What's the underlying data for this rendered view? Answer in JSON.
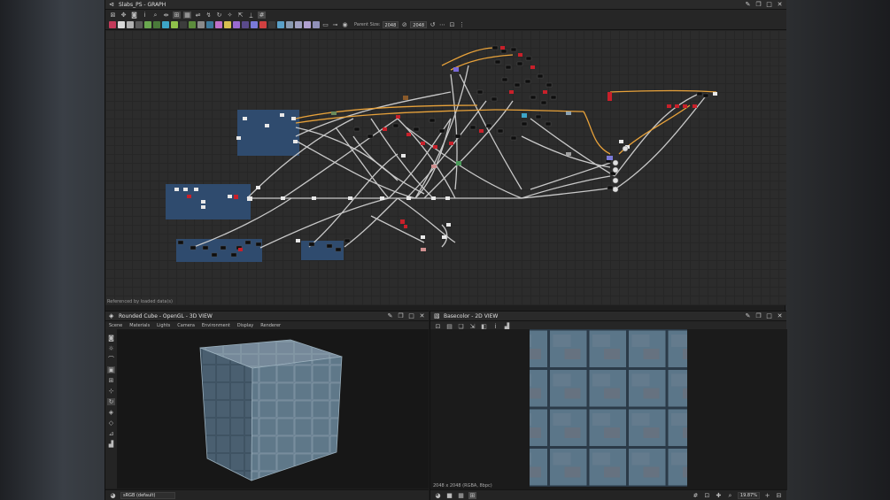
{
  "graph_panel": {
    "title": "Slabs_PS - GRAPH",
    "toolbar": {
      "parent_size_label": "Parent Size:",
      "parent_size_value": "2048",
      "size_value": "2048"
    },
    "status_text": "Referenced by loaded data(s)"
  },
  "view3d": {
    "title": "Rounded Cube - OpenGL - 3D VIEW",
    "menu": [
      "Scene",
      "Materials",
      "Lights",
      "Camera",
      "Environment",
      "Display",
      "Renderer"
    ],
    "color_space": "sRGB (default)"
  },
  "view2d": {
    "title": "Basecolor - 2D VIEW",
    "texture_info": "2048 x 2048 (RGBA, 8bpc)",
    "zoom": "19.87%"
  },
  "colors": {
    "node_group_blue": "#2f4b6e",
    "wire_gray": "#c9c9c9",
    "wire_orange": "#e8a23a",
    "node_red": "#c8202a",
    "tile_blue": "#5b7689"
  },
  "icons": [
    "graph-icon",
    "cube-icon",
    "image-icon",
    "pin-icon",
    "maximize-icon",
    "close-icon",
    "restore-icon",
    "camera-icon",
    "light-icon",
    "grid-icon",
    "zoom-icon"
  ]
}
